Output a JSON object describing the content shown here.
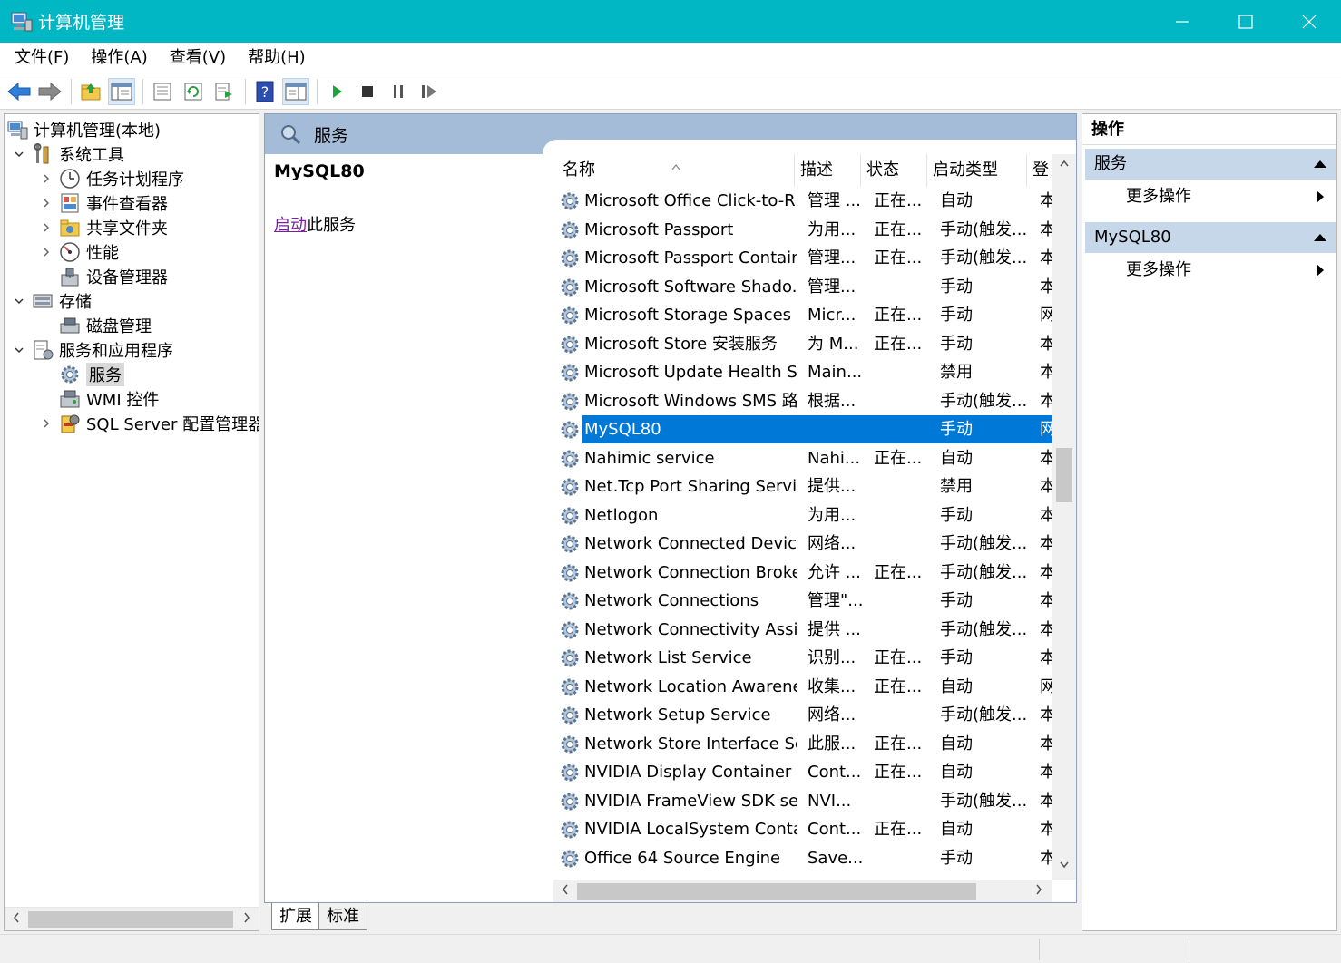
{
  "window": {
    "title": "计算机管理",
    "minimize": "—",
    "maximize": "☐",
    "close": "✕"
  },
  "menu": [
    "文件(F)",
    "操作(A)",
    "查看(V)",
    "帮助(H)"
  ],
  "toolbar": {
    "icons": [
      "back-arrow-icon",
      "forward-arrow-icon",
      "up-folder-icon",
      "show-hide-tree-icon",
      "properties-icon",
      "refresh-icon",
      "export-list-icon",
      "help-icon",
      "show-hide-action-pane-icon",
      "start-service-icon",
      "stop-service-icon",
      "pause-service-icon",
      "restart-service-icon"
    ]
  },
  "tree": {
    "items": [
      {
        "label": "计算机管理(本地)",
        "level": 0,
        "expander": "",
        "icon": "computer-management-icon"
      },
      {
        "label": "系统工具",
        "level": 1,
        "expander": "down",
        "icon": "system-tools-icon"
      },
      {
        "label": "任务计划程序",
        "level": 2,
        "expander": "right",
        "icon": "task-scheduler-icon"
      },
      {
        "label": "事件查看器",
        "level": 2,
        "expander": "right",
        "icon": "event-viewer-icon"
      },
      {
        "label": "共享文件夹",
        "level": 2,
        "expander": "right",
        "icon": "shared-folders-icon"
      },
      {
        "label": "性能",
        "level": 2,
        "expander": "right",
        "icon": "performance-icon"
      },
      {
        "label": "设备管理器",
        "level": 2,
        "expander": "",
        "icon": "device-manager-icon"
      },
      {
        "label": "存储",
        "level": 1,
        "expander": "down",
        "icon": "storage-icon"
      },
      {
        "label": "磁盘管理",
        "level": 2,
        "expander": "",
        "icon": "disk-management-icon"
      },
      {
        "label": "服务和应用程序",
        "level": 1,
        "expander": "down",
        "icon": "services-applications-icon"
      },
      {
        "label": "服务",
        "level": 2,
        "expander": "",
        "icon": "services-gear-icon",
        "selected": true
      },
      {
        "label": "WMI 控件",
        "level": 2,
        "expander": "",
        "icon": "wmi-control-icon"
      },
      {
        "label": "SQL Server 配置管理器",
        "level": 2,
        "expander": "right",
        "icon": "sql-config-icon"
      }
    ]
  },
  "center": {
    "header_title": "服务",
    "selected_service": "MySQL80",
    "action_link": "启动",
    "action_suffix": "此服务",
    "columns": [
      "名称",
      "描述",
      "状态",
      "启动类型",
      "登"
    ],
    "rows": [
      {
        "name": "Microsoft Office Click-to-R...",
        "desc": "管理 ...",
        "status": "正在...",
        "startup": "自动",
        "logon": "本"
      },
      {
        "name": "Microsoft Passport",
        "desc": "为用...",
        "status": "正在...",
        "startup": "手动(触发...",
        "logon": "本"
      },
      {
        "name": "Microsoft Passport Container",
        "desc": "管理...",
        "status": "正在...",
        "startup": "手动(触发...",
        "logon": "本"
      },
      {
        "name": "Microsoft Software Shado...",
        "desc": "管理...",
        "status": "",
        "startup": "手动",
        "logon": "本"
      },
      {
        "name": "Microsoft Storage Spaces S...",
        "desc": "Micr...",
        "status": "正在...",
        "startup": "手动",
        "logon": "网"
      },
      {
        "name": "Microsoft Store 安装服务",
        "desc": "为 M...",
        "status": "正在...",
        "startup": "手动",
        "logon": "本"
      },
      {
        "name": "Microsoft Update Health S...",
        "desc": "Main...",
        "status": "",
        "startup": "禁用",
        "logon": "本"
      },
      {
        "name": "Microsoft Windows SMS 路...",
        "desc": "根据...",
        "status": "",
        "startup": "手动(触发...",
        "logon": "本"
      },
      {
        "name": "MySQL80",
        "desc": "",
        "status": "",
        "startup": "手动",
        "logon": "网",
        "selected": true
      },
      {
        "name": "Nahimic service",
        "desc": "Nahi...",
        "status": "正在...",
        "startup": "自动",
        "logon": "本"
      },
      {
        "name": "Net.Tcp Port Sharing Service",
        "desc": "提供...",
        "status": "",
        "startup": "禁用",
        "logon": "本"
      },
      {
        "name": "Netlogon",
        "desc": "为用...",
        "status": "",
        "startup": "手动",
        "logon": "本"
      },
      {
        "name": "Network Connected Devic...",
        "desc": "网络...",
        "status": "",
        "startup": "手动(触发...",
        "logon": "本"
      },
      {
        "name": "Network Connection Broker",
        "desc": "允许 ...",
        "status": "正在...",
        "startup": "手动(触发...",
        "logon": "本"
      },
      {
        "name": "Network Connections",
        "desc": "管理\"...",
        "status": "",
        "startup": "手动",
        "logon": "本"
      },
      {
        "name": "Network Connectivity Assis...",
        "desc": "提供 ...",
        "status": "",
        "startup": "手动(触发...",
        "logon": "本"
      },
      {
        "name": "Network List Service",
        "desc": "识别...",
        "status": "正在...",
        "startup": "手动",
        "logon": "本"
      },
      {
        "name": "Network Location Awarene...",
        "desc": "收集...",
        "status": "正在...",
        "startup": "自动",
        "logon": "网"
      },
      {
        "name": "Network Setup Service",
        "desc": "网络...",
        "status": "",
        "startup": "手动(触发...",
        "logon": "本"
      },
      {
        "name": "Network Store Interface Se...",
        "desc": "此服...",
        "status": "正在...",
        "startup": "自动",
        "logon": "本"
      },
      {
        "name": "NVIDIA Display Container LS",
        "desc": "Cont...",
        "status": "正在...",
        "startup": "自动",
        "logon": "本"
      },
      {
        "name": "NVIDIA FrameView SDK se...",
        "desc": "NVI...",
        "status": "",
        "startup": "手动(触发...",
        "logon": "本"
      },
      {
        "name": "NVIDIA LocalSystem Conta...",
        "desc": "Cont...",
        "status": "正在...",
        "startup": "自动",
        "logon": "本"
      },
      {
        "name": "Office 64 Source Engine",
        "desc": "Save...",
        "status": "",
        "startup": "手动",
        "logon": "本"
      }
    ],
    "tabs": [
      "扩展",
      "标准"
    ]
  },
  "actions": {
    "title": "操作",
    "groups": [
      {
        "label": "服务",
        "item": "更多操作"
      },
      {
        "label": "MySQL80",
        "item": "更多操作"
      }
    ]
  },
  "colors": {
    "titlebar": "#00b7c3",
    "selection": "#0078d7",
    "pane_header": "#a4bcd8",
    "action_group": "#c7d7ea"
  }
}
